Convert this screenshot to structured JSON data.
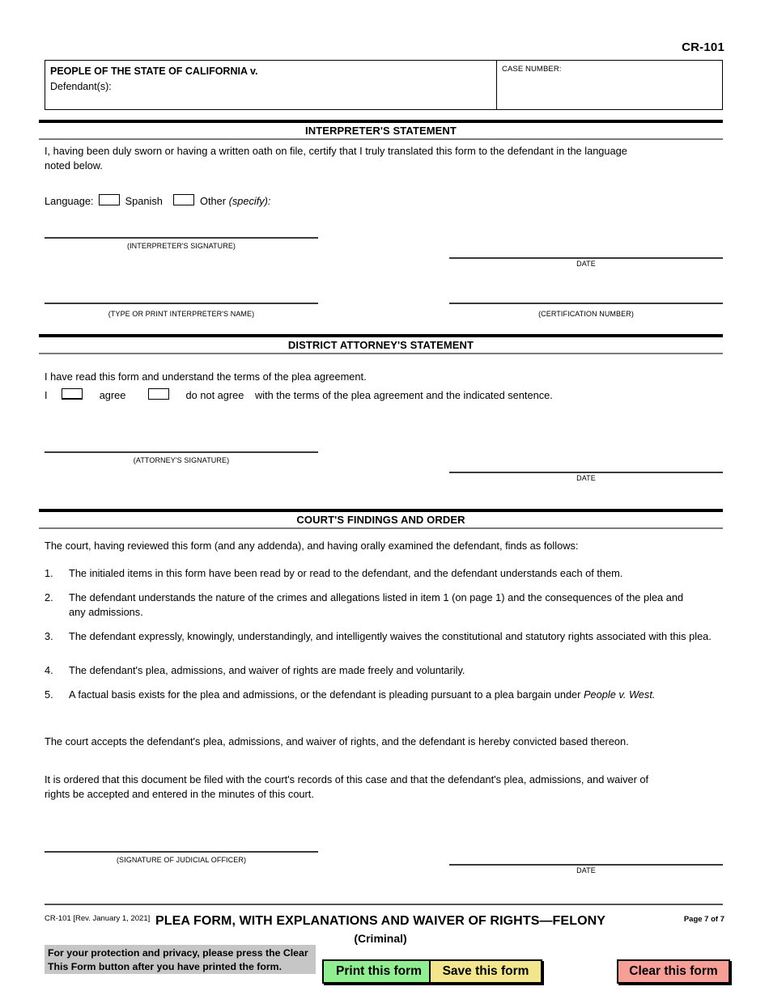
{
  "header": {
    "form_number": "CR-101",
    "party_title": "PEOPLE OF THE STATE OF CALIFORNIA",
    "party_v": "v.",
    "defendant_label": "Defendant(s):",
    "case_number_label": "CASE NUMBER:"
  },
  "interpreter": {
    "section_title": "INTERPRETER'S STATEMENT",
    "statement": "I, having been duly sworn or having a written oath on file, certify that I truly translated this form to the defendant in the language noted below.",
    "language_label": "Language:",
    "spanish_label": "Spanish",
    "other_label": "Other",
    "specify_label": "(specify):",
    "signature_caption": "(INTERPRETER'S SIGNATURE)",
    "date_caption": "DATE",
    "name_caption": "(TYPE OR PRINT INTERPRETER'S NAME)",
    "certification_caption": "(CERTIFICATION NUMBER)"
  },
  "district_attorney": {
    "section_title": "DISTRICT ATTORNEY'S STATEMENT",
    "statement": "I have read this form and understand the terms of the plea agreement.",
    "i_label": "I",
    "agree_label": "agree",
    "do_not_agree_label": "do not agree",
    "tail_text": "with the terms of the plea agreement and the indicated sentence.",
    "signature_caption": "(ATTORNEY'S SIGNATURE)",
    "date_caption": "DATE"
  },
  "court_findings": {
    "section_title": "COURT'S FINDINGS AND ORDER",
    "intro": "The court, having reviewed this form (and any addenda), and having orally examined the defendant, finds as follows:",
    "items": [
      {
        "number": "1.",
        "text": "The initialed items in this form have been read by or read to the defendant, and the defendant understands each of them."
      },
      {
        "number": "2.",
        "text": "The defendant understands the nature of the crimes and allegations listed in item 1 (on page 1) and the consequences of the plea and any admissions."
      },
      {
        "number": "3.",
        "text": "The defendant expressly, knowingly, understandingly, and intelligently waives the constitutional and statutory rights associated with this plea."
      },
      {
        "number": "4.",
        "text": "The defendant's plea, admissions, and waiver of rights are made freely and voluntarily."
      },
      {
        "number": "5.",
        "text_before": "A factual basis exists for the plea and admissions, or the defendant is pleading pursuant to a plea bargain under ",
        "text_italic": "People v. West."
      }
    ],
    "paragraph_accept": "The court accepts the defendant's plea, admissions, and waiver of rights, and the defendant is hereby convicted based thereon.",
    "paragraph_order": "It is ordered that this document be filed with the court's records of this case and that the defendant's plea, admissions, and waiver of rights be accepted and entered in the minutes of this court.",
    "judicial_signature_caption": "(SIGNATURE OF JUDICIAL OFFICER)",
    "judicial_date_caption": "DATE"
  },
  "footer": {
    "revision": "CR-101 [Rev. January 1, 2021]",
    "title": "PLEA FORM, WITH EXPLANATIONS AND WAIVER OF RIGHTS—FELONY",
    "subtitle": "(Criminal)",
    "page_label": "Page 7 of 7",
    "privacy_note": "For your protection and privacy, please press the Clear This Form button after you have printed the form.",
    "print_button": "Print this form",
    "save_button": "Save this form",
    "clear_button": "Clear this form",
    "colors": {
      "print": "#90ee90",
      "save": "#f2e68c",
      "clear": "#f79e96",
      "privacy_bg": "#c6c6c6"
    }
  }
}
